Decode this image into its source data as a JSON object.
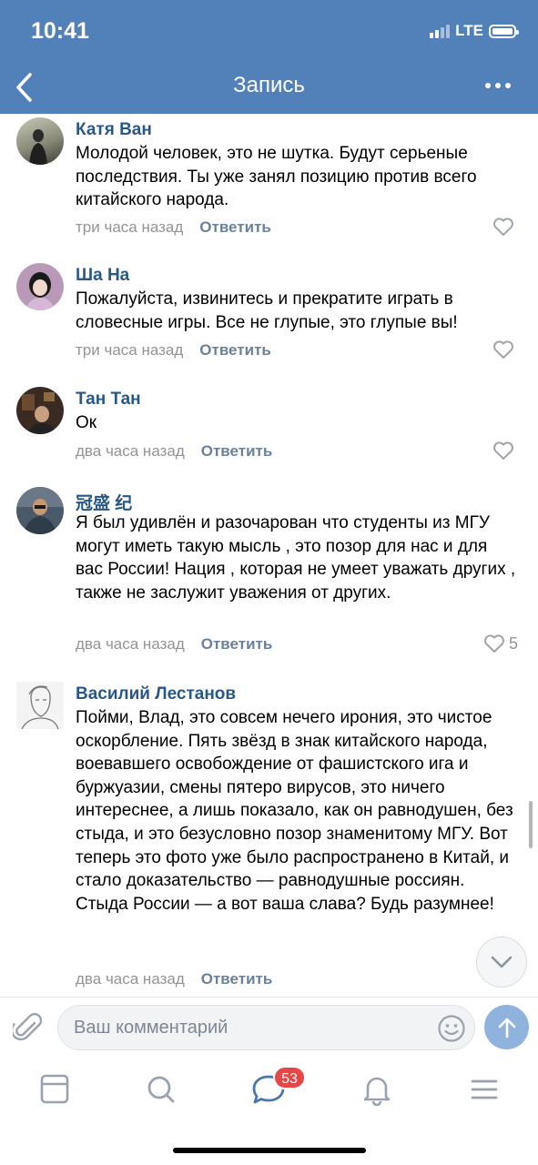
{
  "status": {
    "time": "10:41",
    "network": "LTE"
  },
  "nav": {
    "title": "Запись"
  },
  "comments": [
    {
      "name": "Катя Ван",
      "text": "Молодой человек, это не шутка. Будут серьеные последствия. Ты уже занял позицию против всего китайского народа.",
      "time": "три часа назад",
      "reply": "Ответить",
      "likes": ""
    },
    {
      "name": "Ша На",
      "text": "Пожалуйста, извинитесь и прекратите играть в словесные игры.  Все не глупые, это глупые вы!",
      "time": "три часа назад",
      "reply": "Ответить",
      "likes": ""
    },
    {
      "name": "Тан Тан",
      "text": "Ок",
      "time": "два часа назад",
      "reply": "Ответить",
      "likes": ""
    },
    {
      "name": "冠盛 纪",
      "text": "Я был удивлён и разочарован что студенты из МГУ могут иметь такую мысль , это позор для нас и для вас России!  Нация , которая не умеет уважать других , также не заслужит уважения от других.",
      "time": "два часа назад",
      "reply": "Ответить",
      "likes": "5"
    },
    {
      "name": "Василий Лестанов",
      "text": "Пойми, Влад, это совсем нечего ирония, это чистое оскорбление. Пять звёзд в знак китайского народа, воевавшего освобождение от фашистского ига и буржуазии, смены пятеро вирусов, это ничего интереснее, а лишь показало, как он равнодушен, без стыда, и это безусловно позор знаменитому МГУ. Вот теперь это фото уже было распространено в Китай, и стало доказательство — равнодушные россиян. Стыда России — а вот ваша слава? Будь разумнее!",
      "time": "два часа назад",
      "reply": "Ответить",
      "likes": ""
    }
  ],
  "compose": {
    "placeholder": "Ваш комментарий"
  },
  "tabbar": {
    "messages_badge": "53"
  },
  "colors": {
    "header": "#5181b8",
    "name": "#2a5885",
    "badge": "#e64646",
    "send": "#8fb3dd"
  }
}
